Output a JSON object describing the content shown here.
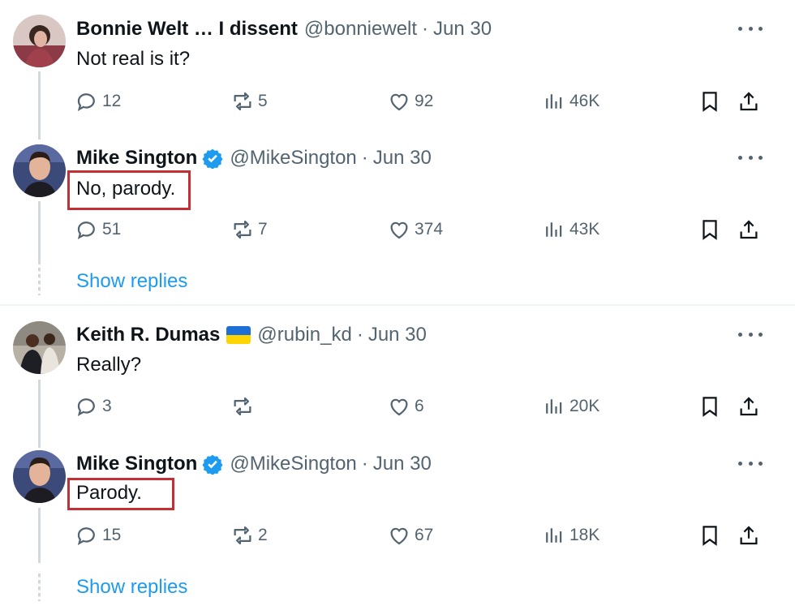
{
  "threads": [
    {
      "tweets": [
        {
          "name": "Bonnie Welt … I dissent",
          "handle": "@bonniewelt",
          "date": "Jun 30",
          "text": "Not real is it?",
          "verified": false,
          "replies": "12",
          "retweets": "5",
          "likes": "92",
          "views": "46K"
        },
        {
          "name": "Mike Sington",
          "handle": "@MikeSington",
          "date": "Jun 30",
          "text": "No, parody.",
          "verified": true,
          "replies": "51",
          "retweets": "7",
          "likes": "374",
          "views": "43K"
        }
      ],
      "show_replies": "Show replies"
    },
    {
      "tweets": [
        {
          "name": "Keith R. Dumas",
          "handle": "@rubin_kd",
          "date": "Jun 30",
          "text": "Really?",
          "verified": false,
          "flag": "ukraine-flag",
          "replies": "3",
          "retweets": "",
          "likes": "6",
          "views": "20K"
        },
        {
          "name": "Mike Sington",
          "handle": "@MikeSington",
          "date": "Jun 30",
          "text": "Parody.",
          "verified": true,
          "replies": "15",
          "retweets": "2",
          "likes": "67",
          "views": "18K"
        }
      ],
      "show_replies": "Show replies"
    }
  ],
  "separator_dot": "·",
  "colors": {
    "text": "#0f1419",
    "secondary": "#536471",
    "link": "#1d9bf0",
    "verified": "#1d9bf0",
    "highlight_box": "#c22f35",
    "thread_line": "#cfd9de"
  }
}
